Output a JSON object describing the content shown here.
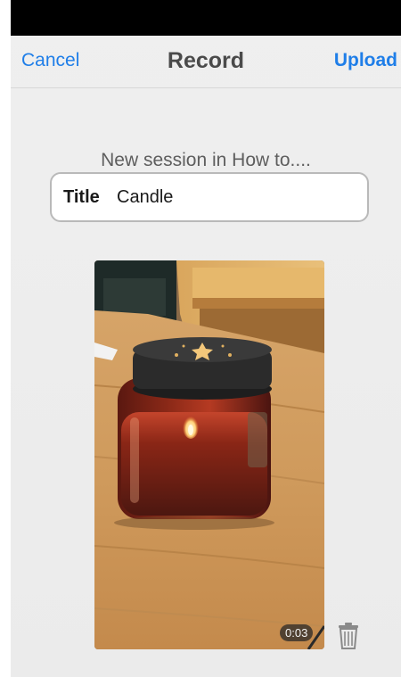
{
  "nav": {
    "cancel_label": "Cancel",
    "title": "Record",
    "upload_label": "Upload"
  },
  "session": {
    "label": "New session in How to...."
  },
  "title_field": {
    "label": "Title",
    "value": "Candle"
  },
  "video": {
    "duration": "0:03"
  },
  "colors": {
    "accent": "#1f7ee8",
    "status_bar": "#000000",
    "background": "#efefef"
  },
  "icons": {
    "trash": "trash-icon"
  }
}
